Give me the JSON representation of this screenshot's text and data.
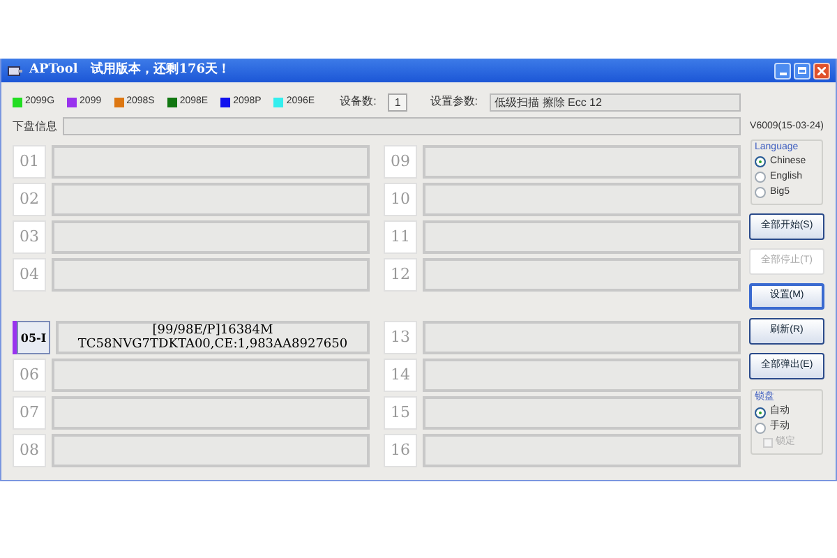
{
  "window": {
    "title": "APTool   试用版本，还剩176天！"
  },
  "legend": [
    {
      "label": "2099G",
      "color": "#22dd22"
    },
    {
      "label": "2099",
      "color": "#9933ee"
    },
    {
      "label": "2098S",
      "color": "#dd7711"
    },
    {
      "label": "2098E",
      "color": "#117711"
    },
    {
      "label": "2098P",
      "color": "#1111ee"
    },
    {
      "label": "2096E",
      "color": "#33eeee"
    }
  ],
  "device_count": {
    "label": "设备数:",
    "value": "1"
  },
  "settings": {
    "label": "设置参数:",
    "value": "低级扫描 擦除 Ecc 12"
  },
  "version": "V6009(15-03-24)",
  "disk_info": {
    "label": "下盘信息"
  },
  "slots": [
    {
      "label": "01",
      "active": false
    },
    {
      "label": "02",
      "active": false
    },
    {
      "label": "03",
      "active": false
    },
    {
      "label": "04",
      "active": false
    },
    {
      "label": "05-I",
      "active": true,
      "color": "#9933ee",
      "lines": [
        "[99/98E/P]16384M",
        "TC58NVG7TDKTA00,CE:1,983AA8927650"
      ]
    },
    {
      "label": "06",
      "active": false
    },
    {
      "label": "07",
      "active": false
    },
    {
      "label": "08",
      "active": false
    },
    {
      "label": "09",
      "active": false
    },
    {
      "label": "10",
      "active": false
    },
    {
      "label": "11",
      "active": false
    },
    {
      "label": "12",
      "active": false
    },
    {
      "label": "13",
      "active": false
    },
    {
      "label": "14",
      "active": false
    },
    {
      "label": "15",
      "active": false
    },
    {
      "label": "16",
      "active": false
    }
  ],
  "language": {
    "title": "Language",
    "options": [
      {
        "label": "Chinese",
        "selected": true
      },
      {
        "label": "English",
        "selected": false
      },
      {
        "label": "Big5",
        "selected": false
      }
    ]
  },
  "buttons": [
    {
      "label": "全部开始(S)",
      "disabled": false,
      "focused": false
    },
    {
      "label": "全部停止(T)",
      "disabled": true,
      "focused": false
    },
    {
      "label": "设置(M)",
      "disabled": false,
      "focused": true
    },
    {
      "label": "刷新(R)",
      "disabled": false,
      "focused": false
    },
    {
      "label": "全部弹出(E)",
      "disabled": false,
      "focused": false
    }
  ],
  "lock": {
    "title": "锁盘",
    "options": [
      {
        "label": "自动",
        "selected": true
      },
      {
        "label": "手动",
        "selected": false
      }
    ],
    "checkbox": {
      "label": "锁定",
      "checked": false,
      "disabled": true
    }
  }
}
